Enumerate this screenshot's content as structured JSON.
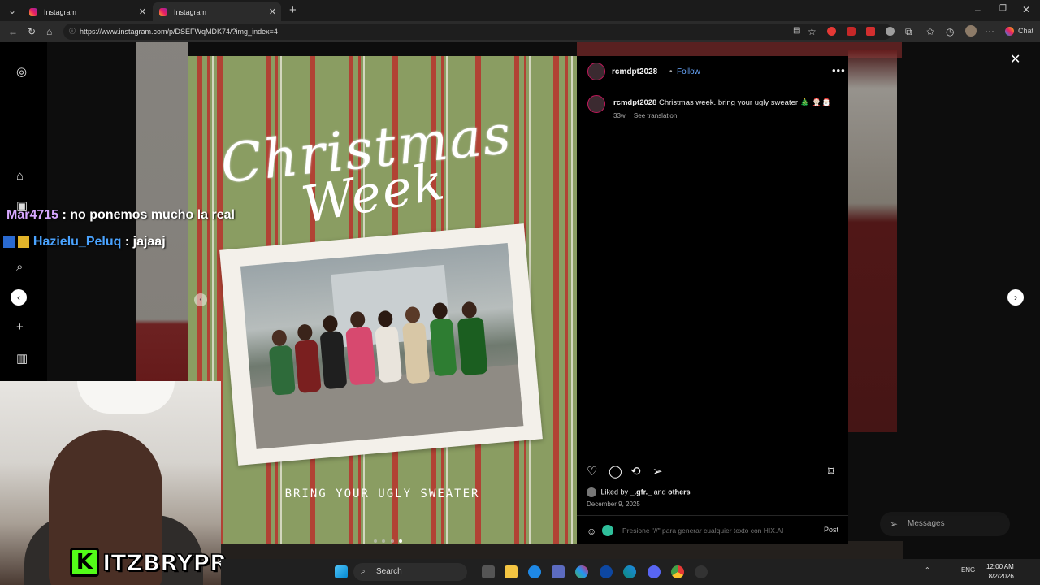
{
  "browser": {
    "tabs": [
      {
        "title": "Instagram"
      },
      {
        "title": "Instagram"
      }
    ],
    "url": "https://www.instagram.com/p/DSEFWqMDK74/?img_index=4",
    "extensions_label": "Chat"
  },
  "post": {
    "image": {
      "title_line1": "Christmas",
      "title_line2": "Week",
      "subtitle": "BRING YOUR UGLY SWEATER",
      "carousel_count": 4,
      "carousel_active": 4
    },
    "author": "rcmdpt2028",
    "follow_label": "Follow",
    "separator": "•",
    "more_label": "•••",
    "caption_user": "rcmdpt2028",
    "caption_text": "Christmas week. bring your ugly sweater 🎄 🤶🏻🎅🏻",
    "caption_age": "33w",
    "see_translation": "See translation",
    "liked_prefix": "Liked by",
    "liked_user": "_.gfr._",
    "liked_and": "and",
    "liked_others": "others",
    "date": "December 9, 2025",
    "comment_placeholder": "Presione \"//\" para generar cualquier texto con HIX.AI",
    "post_button": "Post"
  },
  "overlay": {
    "messages_label": "Messages",
    "chat": [
      {
        "user": "Mar4715",
        "message": ": no ponemos mucho la real"
      },
      {
        "user": "Hazielu_Peluq",
        "message": ": jajaaj"
      }
    ],
    "streamer_handle": "ITZBRYPR",
    "kick_letter": "K"
  },
  "taskbar": {
    "search_label": "Search",
    "lang": "ENG",
    "time": "12:00 AM",
    "date": "8/2/2026"
  },
  "icons": {
    "home": "home-icon",
    "search": "search-icon",
    "create": "plus-icon",
    "close": "close-icon",
    "like": "heart-icon",
    "comment": "comment-icon",
    "share": "send-icon",
    "save": "bookmark-icon"
  },
  "colors": {
    "instagram_link": "#6aa9ff",
    "post_background": "#8a9d62",
    "stripe_red": "#b8332c",
    "kick_green": "#53fc18"
  }
}
